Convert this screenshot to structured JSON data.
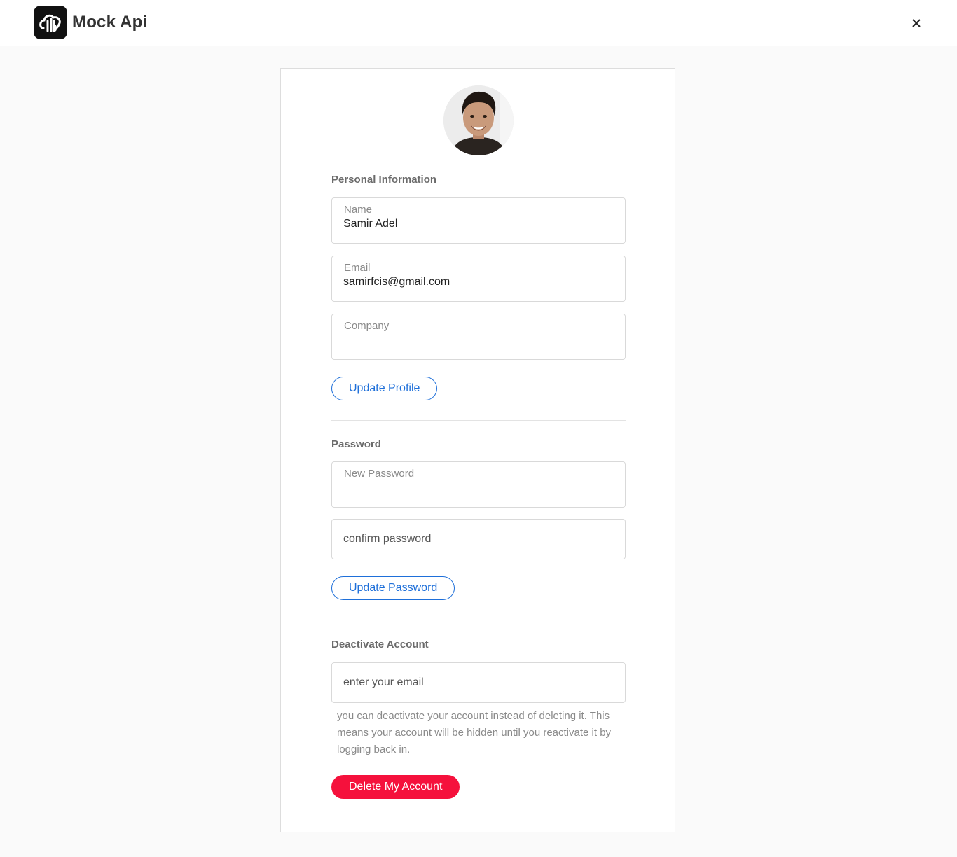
{
  "header": {
    "app_name": "Mock Api",
    "logo_icon": "cloud-api-logo-icon",
    "close_icon": "close-icon"
  },
  "profile": {
    "avatar": "user-avatar-photo",
    "personal_title": "Personal Information",
    "name_label": "Name",
    "name_value": "Samir Adel",
    "email_label": "Email",
    "email_value": "samirfcis@gmail.com",
    "company_label": "Company",
    "company_value": "",
    "update_label": "Update Profile"
  },
  "password": {
    "title": "Password",
    "new_placeholder": "New Password",
    "confirm_placeholder": "confirm password",
    "update_label": "Update Password"
  },
  "deactivate": {
    "title": "Deactivate Account",
    "email_placeholder": "enter your email",
    "help_text": "you can deactivate your account instead of deleting it. This means your account will be hidden until you reactivate it by logging back in.",
    "delete_label": "Delete My Account"
  },
  "colors": {
    "accent": "#1e6fd9",
    "danger": "#f5113c",
    "background": "#fafafa"
  }
}
